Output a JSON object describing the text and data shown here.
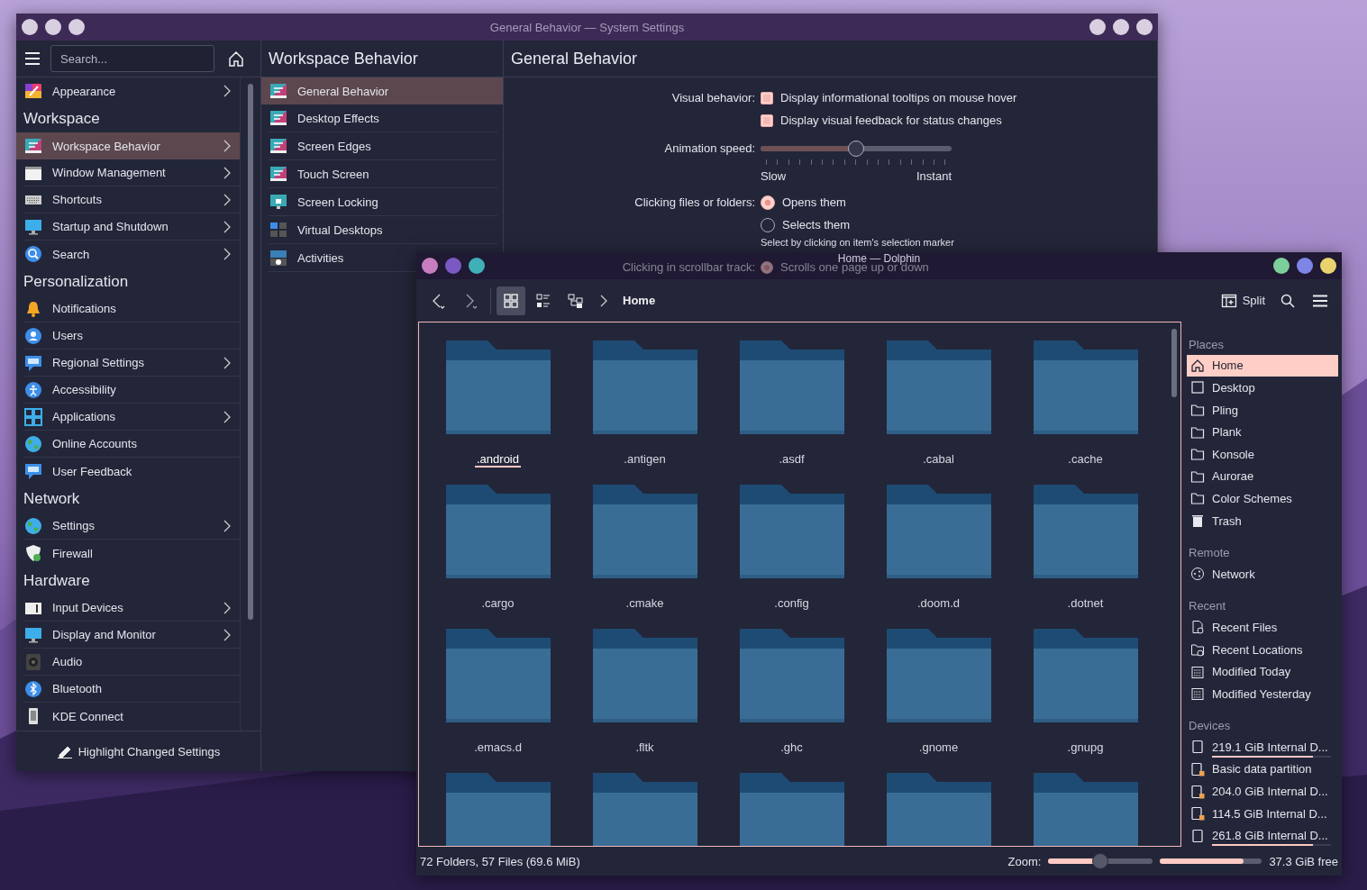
{
  "settings_window": {
    "title": "General Behavior — System Settings",
    "search": {
      "placeholder": "Search..."
    },
    "sidebar": {
      "items": [
        {
          "kind": "item",
          "label": "Appearance",
          "expandable": true,
          "selected": false
        },
        {
          "kind": "header",
          "label": "Workspace"
        },
        {
          "kind": "item",
          "label": "Workspace Behavior",
          "expandable": true,
          "selected": true
        },
        {
          "kind": "item",
          "label": "Window Management",
          "expandable": true,
          "selected": false
        },
        {
          "kind": "item",
          "label": "Shortcuts",
          "expandable": true,
          "selected": false
        },
        {
          "kind": "item",
          "label": "Startup and Shutdown",
          "expandable": true,
          "selected": false
        },
        {
          "kind": "item",
          "label": "Search",
          "expandable": true,
          "selected": false
        },
        {
          "kind": "header",
          "label": "Personalization"
        },
        {
          "kind": "item",
          "label": "Notifications",
          "expandable": false,
          "selected": false
        },
        {
          "kind": "item",
          "label": "Users",
          "expandable": false,
          "selected": false
        },
        {
          "kind": "item",
          "label": "Regional Settings",
          "expandable": true,
          "selected": false
        },
        {
          "kind": "item",
          "label": "Accessibility",
          "expandable": false,
          "selected": false
        },
        {
          "kind": "item",
          "label": "Applications",
          "expandable": true,
          "selected": false
        },
        {
          "kind": "item",
          "label": "Online Accounts",
          "expandable": false,
          "selected": false
        },
        {
          "kind": "item",
          "label": "User Feedback",
          "expandable": false,
          "selected": false
        },
        {
          "kind": "header",
          "label": "Network"
        },
        {
          "kind": "item",
          "label": "Settings",
          "expandable": true,
          "selected": false
        },
        {
          "kind": "item",
          "label": "Firewall",
          "expandable": false,
          "selected": false
        },
        {
          "kind": "header",
          "label": "Hardware"
        },
        {
          "kind": "item",
          "label": "Input Devices",
          "expandable": true,
          "selected": false
        },
        {
          "kind": "item",
          "label": "Display and Monitor",
          "expandable": true,
          "selected": false
        },
        {
          "kind": "item",
          "label": "Audio",
          "expandable": false,
          "selected": false
        },
        {
          "kind": "item",
          "label": "Bluetooth",
          "expandable": false,
          "selected": false
        },
        {
          "kind": "item",
          "label": "KDE Connect",
          "expandable": false,
          "selected": false
        }
      ]
    },
    "footer_button": "Highlight Changed Settings",
    "subpage": {
      "title": "Workspace Behavior",
      "items": [
        {
          "label": "General Behavior",
          "selected": true
        },
        {
          "label": "Desktop Effects",
          "selected": false
        },
        {
          "label": "Screen Edges",
          "selected": false
        },
        {
          "label": "Touch Screen",
          "selected": false
        },
        {
          "label": "Screen Locking",
          "selected": false
        },
        {
          "label": "Virtual Desktops",
          "selected": false
        },
        {
          "label": "Activities",
          "selected": false
        }
      ]
    },
    "page": {
      "title": "General Behavior",
      "visual_behavior": {
        "label": "Visual behavior:",
        "options": [
          {
            "label": "Display informational tooltips on mouse hover",
            "checked": true
          },
          {
            "label": "Display visual feedback for status changes",
            "checked": true
          }
        ]
      },
      "animation_speed": {
        "label": "Animation speed:",
        "level": 0.5,
        "min_label": "Slow",
        "max_label": "Instant"
      },
      "clicking": {
        "label": "Clicking files or folders:",
        "options": [
          {
            "label": "Opens them",
            "selected": true
          },
          {
            "label": "Selects them",
            "selected": false
          }
        ],
        "hint": "Select by clicking on item's selection marker"
      },
      "scrollbar_track": {
        "label": "Clicking in scrollbar track:",
        "options": [
          {
            "label": "Scrolls one page up or down",
            "selected": true
          }
        ]
      }
    }
  },
  "dolphin_window": {
    "title": "Home — Dolphin",
    "view_modes": [
      {
        "kind": "icons",
        "selected": true
      },
      {
        "kind": "details",
        "selected": false
      },
      {
        "kind": "tree",
        "selected": false
      }
    ],
    "breadcrumb": "Home",
    "split_button": "Split",
    "files": [
      {
        "kind": "folder",
        "name": ".android",
        "current": true
      },
      {
        "kind": "folder",
        "name": ".antigen",
        "current": false
      },
      {
        "kind": "folder",
        "name": ".asdf",
        "current": false
      },
      {
        "kind": "folder",
        "name": ".cabal",
        "current": false
      },
      {
        "kind": "folder",
        "name": ".cache",
        "current": false
      },
      {
        "kind": "folder",
        "name": ".cargo",
        "current": false
      },
      {
        "kind": "folder",
        "name": ".cmake",
        "current": false
      },
      {
        "kind": "folder",
        "name": ".config",
        "current": false
      },
      {
        "kind": "folder",
        "name": ".doom.d",
        "current": false
      },
      {
        "kind": "folder",
        "name": ".dotnet",
        "current": false
      },
      {
        "kind": "folder",
        "name": ".emacs.d",
        "current": false
      },
      {
        "kind": "folder",
        "name": ".fltk",
        "current": false
      },
      {
        "kind": "folder",
        "name": ".ghc",
        "current": false
      },
      {
        "kind": "folder",
        "name": ".gnome",
        "current": false
      },
      {
        "kind": "folder",
        "name": ".gnupg",
        "current": false
      },
      {
        "kind": "folder"
      },
      {
        "kind": "folder"
      },
      {
        "kind": "folder"
      },
      {
        "kind": "folder"
      },
      {
        "kind": "folder"
      }
    ],
    "places": [
      {
        "header": "Places",
        "items": [
          {
            "kind": "home",
            "label": "Home",
            "selected": true
          },
          {
            "kind": "desktop",
            "label": "Desktop",
            "selected": false
          },
          {
            "kind": "folder",
            "label": "Pling",
            "selected": false
          },
          {
            "kind": "folder",
            "label": "Plank",
            "selected": false
          },
          {
            "kind": "folder",
            "label": "Konsole",
            "selected": false
          },
          {
            "kind": "folder",
            "label": "Aurorae",
            "selected": false
          },
          {
            "kind": "folder",
            "label": "Color Schemes",
            "selected": false
          },
          {
            "kind": "trash",
            "label": "Trash",
            "selected": false
          }
        ]
      },
      {
        "header": "Remote",
        "items": [
          {
            "kind": "network",
            "label": "Network",
            "selected": false
          }
        ]
      },
      {
        "header": "Recent",
        "items": [
          {
            "kind": "recent-file",
            "label": "Recent Files",
            "selected": false
          },
          {
            "kind": "recent-folder",
            "label": "Recent Locations",
            "selected": false
          },
          {
            "kind": "calendar",
            "label": "Modified Today",
            "selected": false
          },
          {
            "kind": "calendar",
            "label": "Modified Yesterday",
            "selected": false
          }
        ]
      },
      {
        "header": "Devices",
        "items": [
          {
            "kind": "drive",
            "label": "219.1 GiB Internal D...",
            "selected": false,
            "level": 0.85
          },
          {
            "kind": "drive-link",
            "label": "Basic data partition",
            "selected": false
          },
          {
            "kind": "drive-link",
            "label": "204.0 GiB Internal D...",
            "selected": false
          },
          {
            "kind": "drive-link",
            "label": "114.5 GiB Internal D...",
            "selected": false
          },
          {
            "kind": "drive",
            "label": "261.8 GiB Internal D...",
            "selected": false,
            "level": 0.85
          }
        ]
      }
    ],
    "status": {
      "text": "72 Folders, 57 Files (69.6 MiB)",
      "zoom": {
        "label": "Zoom:",
        "level": 0.5
      },
      "free_space": {
        "level": 0.82,
        "text": "37.3 GiB free"
      }
    }
  }
}
